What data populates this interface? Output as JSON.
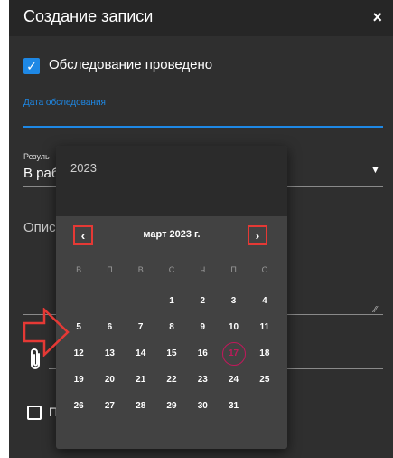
{
  "dialog": {
    "title": "Создание записи",
    "close_icon": "×"
  },
  "form": {
    "examined_checkbox": {
      "label": "Обследование проведено",
      "checked": true,
      "check_glyph": "✓"
    },
    "exam_date": {
      "label": "Дата обследования",
      "value": ""
    },
    "result": {
      "label": "Резуль",
      "value": "В раб",
      "dropdown_glyph": "▼"
    },
    "description": {
      "label": "Опис",
      "resize_glyph": "⁄⁄"
    },
    "attachment": {
      "icon": "paperclip-icon"
    },
    "second_checkbox": {
      "label": "П",
      "checked": false
    }
  },
  "datepicker": {
    "year": "2023",
    "month_label": "март 2023 г.",
    "prev_glyph": "‹",
    "next_glyph": "›",
    "weekdays": [
      "В",
      "П",
      "В",
      "С",
      "Ч",
      "П",
      "С"
    ],
    "leading_empty": 3,
    "days": [
      "1",
      "2",
      "3",
      "4",
      "5",
      "6",
      "7",
      "8",
      "9",
      "10",
      "11",
      "12",
      "13",
      "14",
      "15",
      "16",
      "17",
      "18",
      "19",
      "20",
      "21",
      "22",
      "23",
      "24",
      "25",
      "26",
      "27",
      "28",
      "29",
      "30",
      "31"
    ],
    "today": "17"
  },
  "colors": {
    "accent": "#1e88e5",
    "annotation": "#e53935",
    "today_ring": "#c2185b",
    "dialog_bg": "#2f2f2f",
    "picker_bg": "#424242"
  }
}
